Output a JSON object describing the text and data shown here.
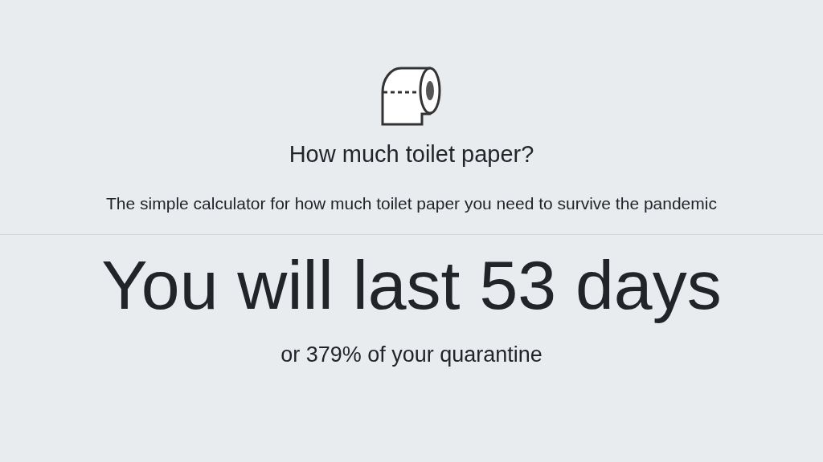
{
  "header": {
    "title": "How much toilet paper?",
    "subtitle": "The simple calculator for how much toilet paper you need to survive the pandemic"
  },
  "result": {
    "headline": "You will last **53** days",
    "detail": "or **379%** of your quarantine"
  }
}
